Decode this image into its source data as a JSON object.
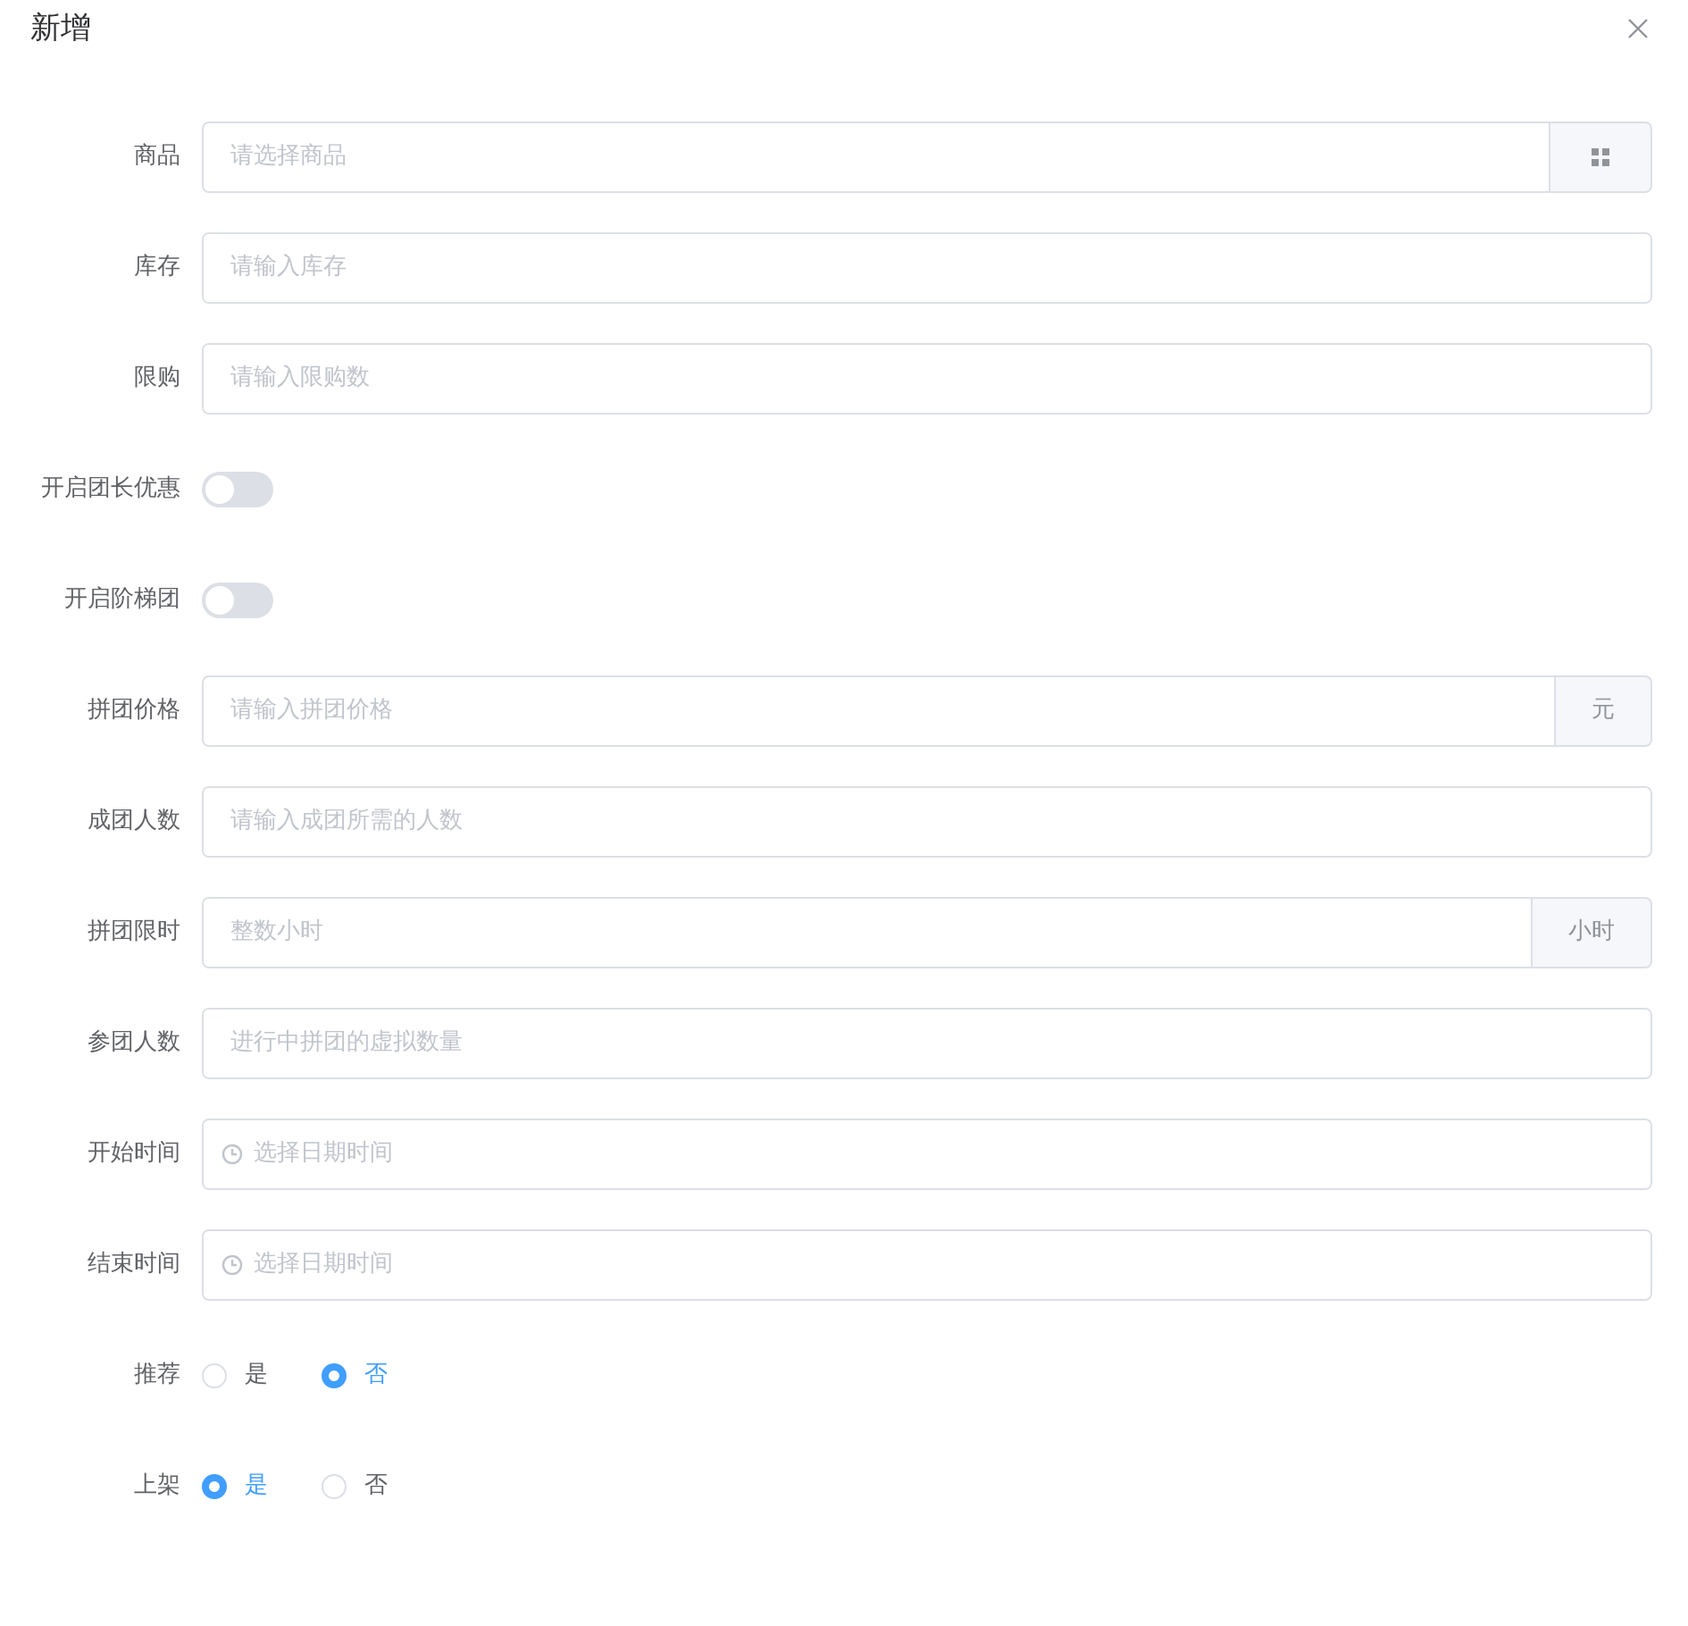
{
  "dialog": {
    "title": "新增"
  },
  "fields": [
    {
      "kind": "picker",
      "label": "商品",
      "placeholder": "请选择商品"
    },
    {
      "kind": "input",
      "label": "库存",
      "placeholder": "请输入库存"
    },
    {
      "kind": "input",
      "label": "限购",
      "placeholder": "请输入限购数"
    },
    {
      "kind": "switch",
      "label": "开启团长优惠",
      "on": false
    },
    {
      "kind": "switch",
      "label": "开启阶梯团",
      "on": false
    },
    {
      "kind": "input",
      "label": "拼团价格",
      "placeholder": "请输入拼团价格",
      "append": "元"
    },
    {
      "kind": "input",
      "label": "成团人数",
      "placeholder": "请输入成团所需的人数"
    },
    {
      "kind": "input",
      "label": "拼团限时",
      "placeholder": "整数小时",
      "append": "小时"
    },
    {
      "kind": "input",
      "label": "参团人数",
      "placeholder": "进行中拼团的虚拟数量"
    },
    {
      "kind": "datetime",
      "label": "开始时间",
      "placeholder": "选择日期时间"
    },
    {
      "kind": "datetime",
      "label": "结束时间",
      "placeholder": "选择日期时间"
    },
    {
      "kind": "radio",
      "label": "推荐",
      "options": [
        {
          "label": "是",
          "selected": false
        },
        {
          "label": "否",
          "selected": true
        }
      ]
    },
    {
      "kind": "radio",
      "label": "上架",
      "options": [
        {
          "label": "是",
          "selected": true
        },
        {
          "label": "否",
          "selected": false
        }
      ]
    }
  ]
}
